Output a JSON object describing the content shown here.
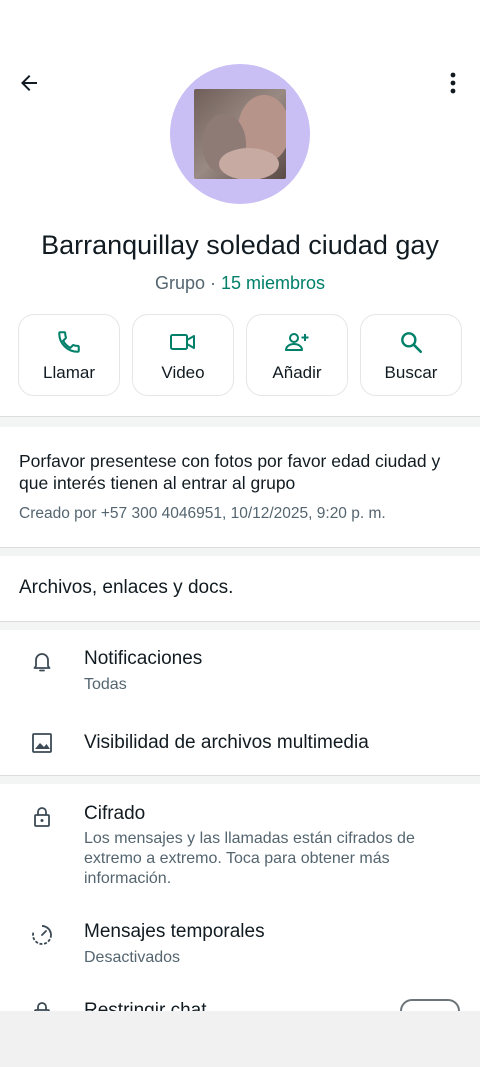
{
  "header": {
    "back_icon": "arrow-left-icon",
    "more_icon": "more-vert-icon"
  },
  "group": {
    "name": "Barranquillay soledad ciudad gay",
    "type": "Grupo",
    "separator": " · ",
    "members": "15 miembros"
  },
  "actions": [
    {
      "label": "Llamar",
      "icon": "phone-icon"
    },
    {
      "label": "Video",
      "icon": "video-icon"
    },
    {
      "label": "Añadir",
      "icon": "add-person-icon"
    },
    {
      "label": "Buscar",
      "icon": "search-icon"
    }
  ],
  "description": {
    "text": "Porfavor presentese con fotos por favor edad ciudad y que interés tienen al entrar al grupo",
    "created_by": "Creado por +57 300 4046951, 10/12/2025, 9:20 p. m."
  },
  "files_label": "Archivos, enlaces y docs.",
  "settings": [
    {
      "title": "Notificaciones",
      "subtitle": "Todas",
      "icon": "bell-icon"
    },
    {
      "title": "Visibilidad de archivos multimedia",
      "icon": "image-icon"
    },
    {
      "title": "Cifrado",
      "subtitle": "Los mensajes y las llamadas están cifrados de extremo a extremo. Toca para obtener más información.",
      "icon": "lock-icon"
    },
    {
      "title": "Mensajes temporales",
      "subtitle": "Desactivados",
      "icon": "timer-icon"
    },
    {
      "title": "Restringir chat",
      "icon": "lock-icon"
    }
  ],
  "colors": {
    "accent": "#008069",
    "avatar_bg": "#c9bff5"
  }
}
